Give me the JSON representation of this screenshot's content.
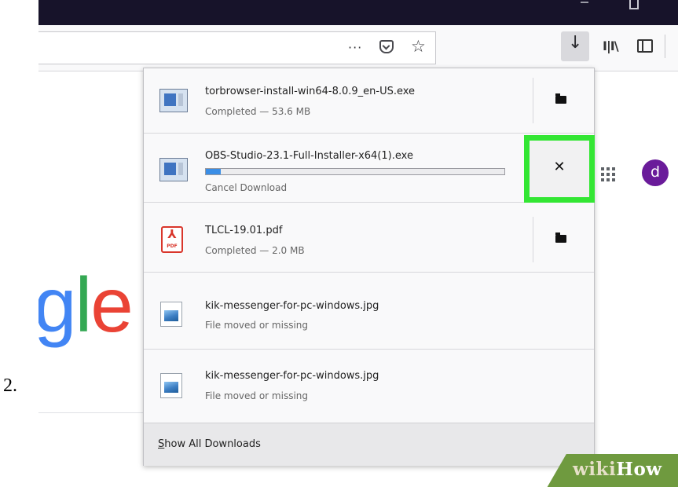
{
  "step": {
    "number": "2."
  },
  "browser": {
    "url_more": "···"
  },
  "google": {
    "logo_g": "g",
    "logo_l": "l",
    "logo_e": "e",
    "avatar_letter": "d"
  },
  "downloads": {
    "items": [
      {
        "name": "torbrowser-install-win64-8.0.9_en-US.exe",
        "status": "Completed — 53.6 MB",
        "icon": "exe-icon"
      },
      {
        "name": "OBS-Studio-23.1-Full-Installer-x64(1).exe",
        "status": "Cancel Download",
        "icon": "exe-icon",
        "progress": 0.05
      },
      {
        "name": "TLCL-19.01.pdf",
        "status": "Completed — 2.0 MB",
        "icon": "pdf-icon",
        "icon_text": "PDF"
      },
      {
        "name": "kik-messenger-for-pc-windows.jpg",
        "status": "File moved or missing",
        "icon": "image-icon"
      },
      {
        "name": "kik-messenger-for-pc-windows.jpg",
        "status": "File moved or missing",
        "icon": "image-icon"
      }
    ],
    "cancel_glyph": "✕",
    "show_all_first": "S",
    "show_all_rest": "how All Downloads",
    "highlight_color": "#33e633"
  },
  "watermark": {
    "wiki": "wiki",
    "how": "How"
  }
}
